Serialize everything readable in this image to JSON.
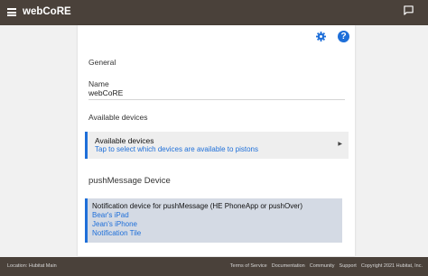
{
  "header": {
    "title": "webCoRE",
    "menu_icon": "hamburger-menu-icon",
    "message_icon": "message-icon"
  },
  "toolbar": {
    "settings_icon": "gear-icon",
    "help_icon": "help-icon",
    "help_glyph": "?"
  },
  "general": {
    "section_label": "General",
    "name_label": "Name",
    "name_value": "webCoRE"
  },
  "available": {
    "section_label": "Available devices",
    "card_title": "Available devices",
    "card_subtitle": "Tap to select which devices are available to pistons",
    "arrow": "▶"
  },
  "push": {
    "section_label": "pushMessage Device",
    "card_title": "Notification device for pushMessage (HE PhoneApp or pushOver)",
    "devices": [
      "Bear's iPad",
      "Jean's iPhone",
      "Notification Tile"
    ]
  },
  "footer": {
    "location": "Location: Hubitat Main",
    "links": [
      "Terms of Service",
      "Documentation",
      "Community",
      "Support"
    ],
    "copyright": "Copyright 2021 Hubitat, Inc."
  },
  "colors": {
    "topbar": "#4a413a",
    "accent": "#1e6fd9",
    "selected_card": "#d4dae4"
  }
}
